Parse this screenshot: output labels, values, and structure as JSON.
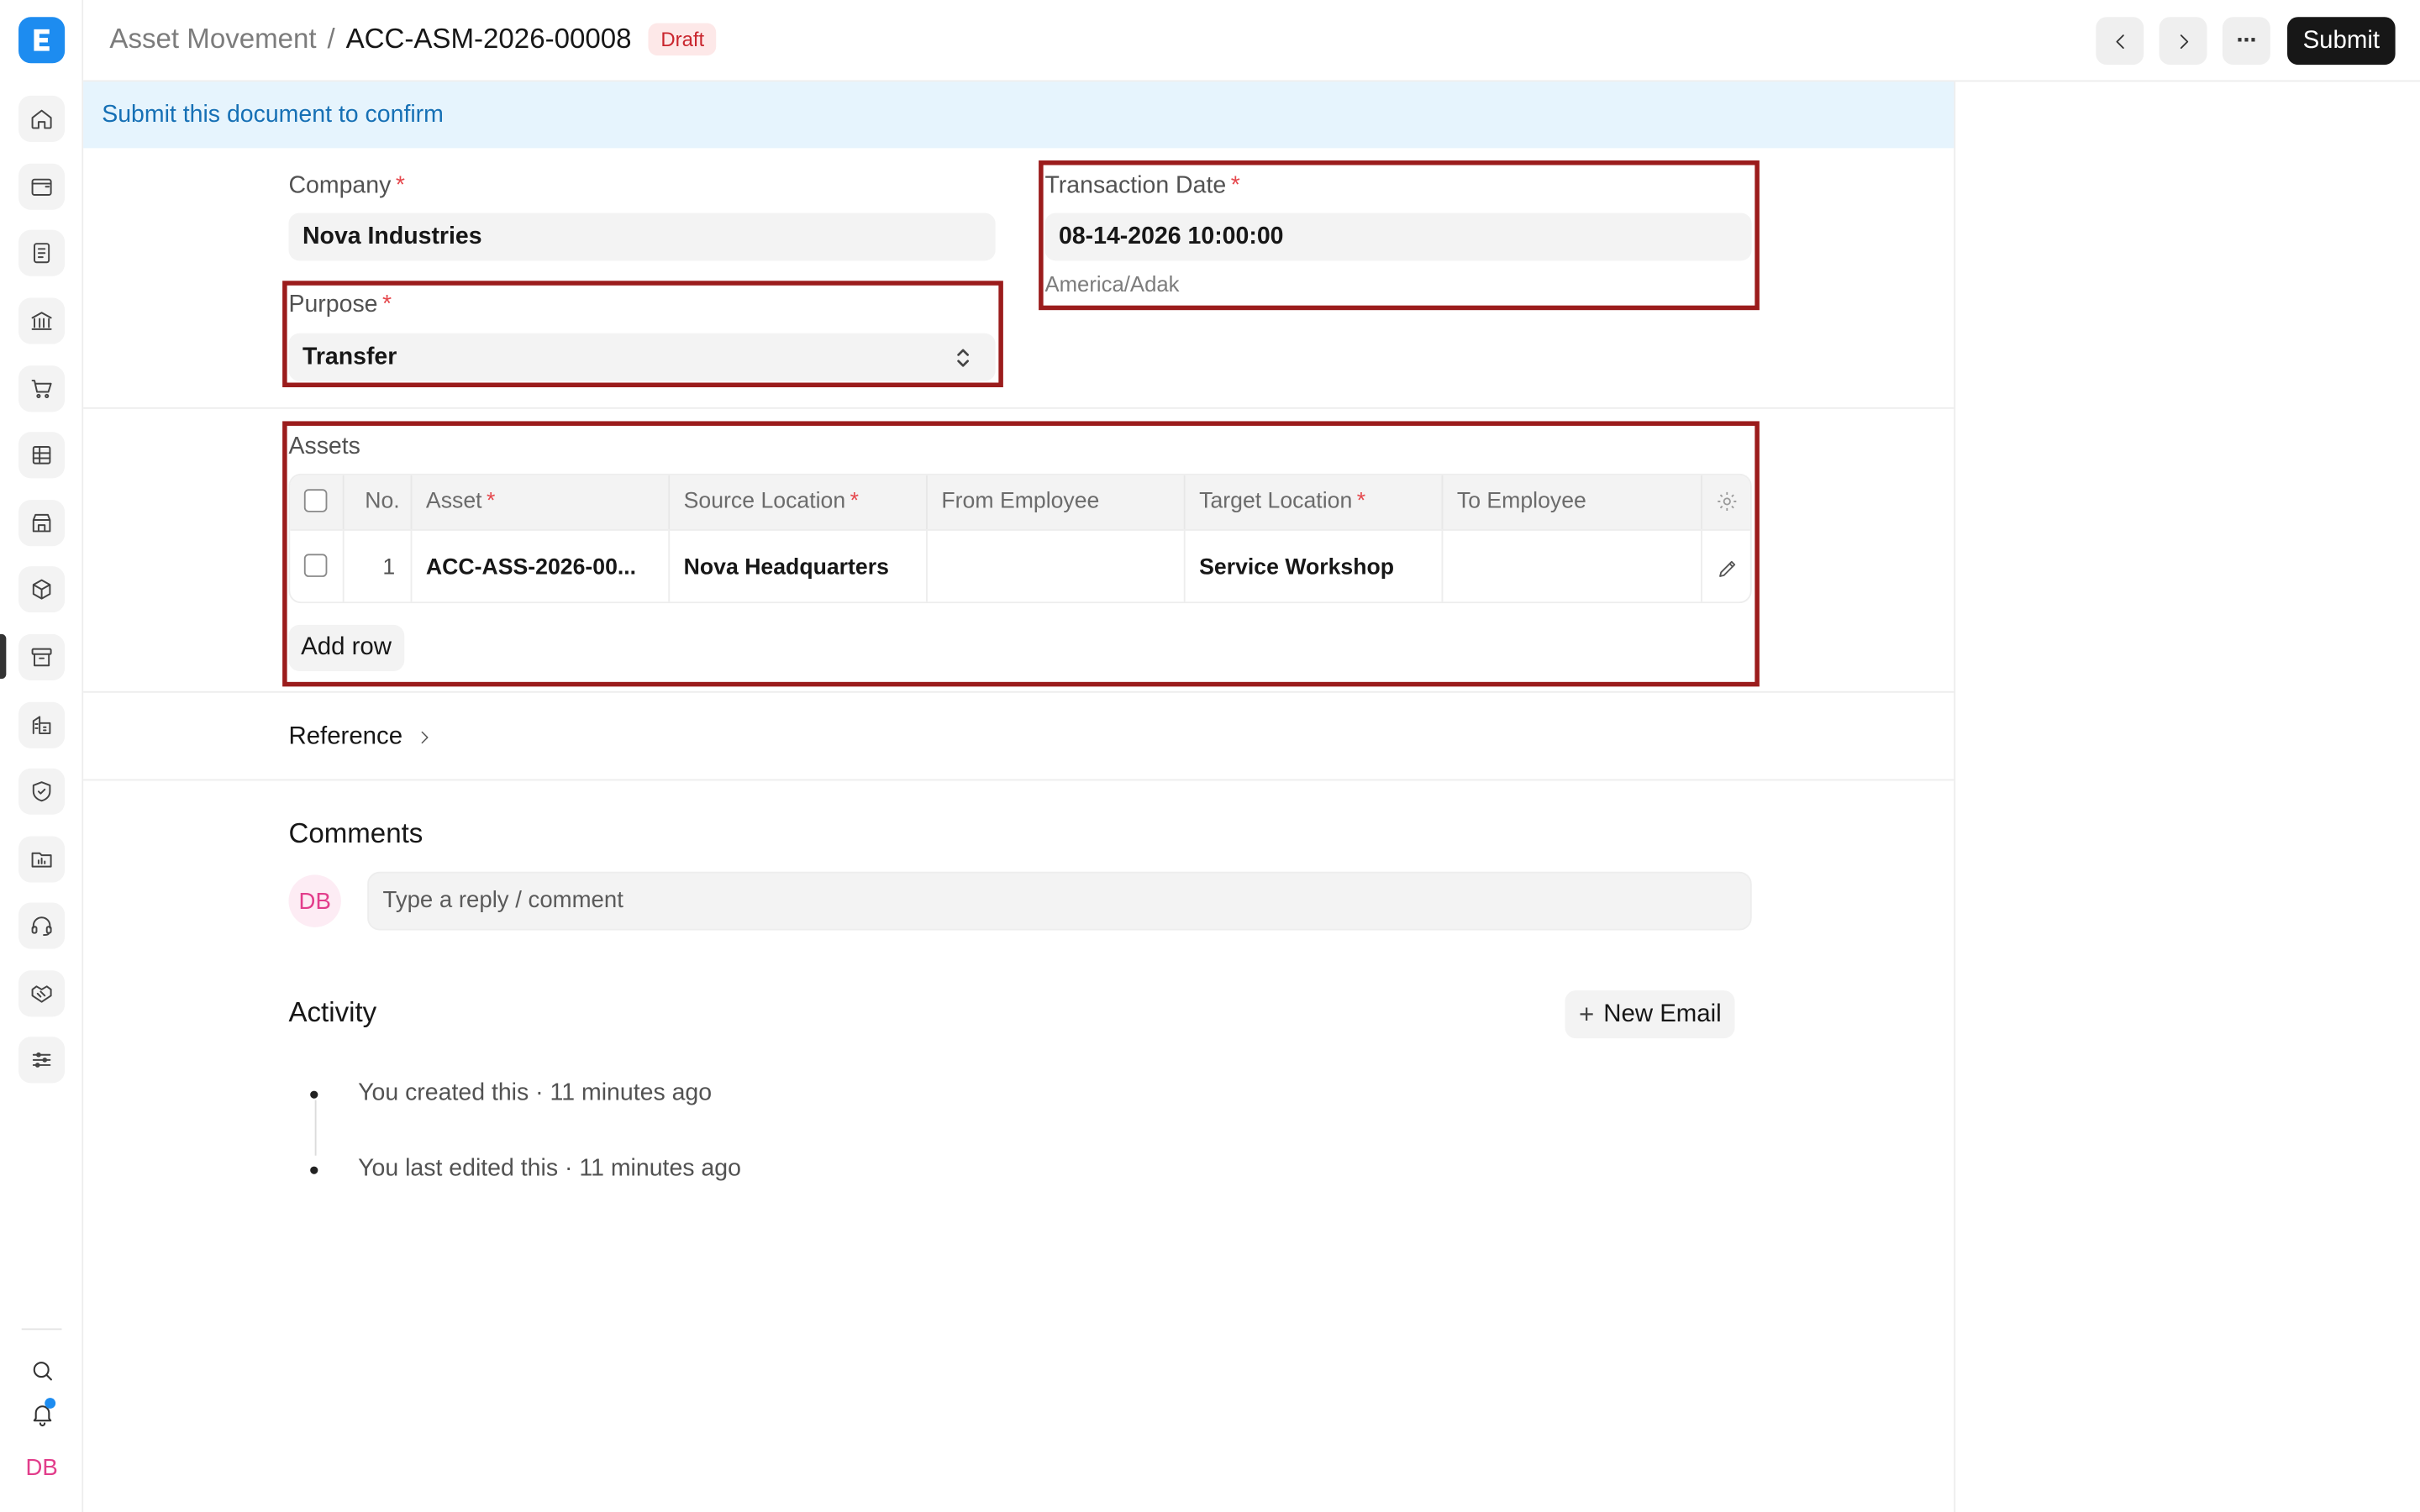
{
  "header": {
    "doctype": "Asset Movement",
    "separator": "/",
    "doc_name": "ACC-ASM-2026-00008",
    "status": "Draft",
    "submit_label": "Submit",
    "more_label": "···"
  },
  "banner": {
    "text": "Submit this document to confirm"
  },
  "form": {
    "company_label": "Company",
    "company_value": "Nova Industries",
    "purpose_label": "Purpose",
    "purpose_value": "Transfer",
    "txn_date_label": "Transaction Date",
    "txn_date_value": "08-14-2026 10:00:00",
    "timezone": "America/Adak",
    "required_mark": "*"
  },
  "assets": {
    "label": "Assets",
    "columns": [
      "No.",
      "Asset",
      "Source Location",
      "From Employee",
      "Target Location",
      "To Employee"
    ],
    "rows": [
      {
        "no": "1",
        "asset": "ACC-ASS-2026-00...",
        "source_location": "Nova Headquarters",
        "from_employee": "",
        "target_location": "Service Workshop",
        "to_employee": ""
      }
    ],
    "add_row_label": "Add row"
  },
  "reference": {
    "label": "Reference"
  },
  "comments": {
    "title": "Comments",
    "avatar_initials": "DB",
    "placeholder": "Type a reply / comment"
  },
  "activity": {
    "title": "Activity",
    "new_email_label": "New Email",
    "items": [
      "You created this · 11 minutes ago",
      "You last edited this · 11 minutes ago"
    ]
  },
  "sidebar": {
    "avatar_initials": "DB",
    "icons": [
      "home-icon",
      "wallet-icon",
      "document-icon",
      "bank-icon",
      "cart-icon",
      "table-icon",
      "store-icon",
      "package-icon",
      "archive-icon",
      "building-icon",
      "shield-icon",
      "folder-chart-icon",
      "headset-icon",
      "handshake-icon",
      "sliders-icon",
      "search-icon",
      "bell-icon"
    ]
  },
  "colors": {
    "accent": "#1d8cf0",
    "highlight_border": "#9b1c1c",
    "draft_badge_bg": "#fde8e8",
    "draft_badge_text": "#c9252d",
    "banner_bg": "#e6f4fd",
    "banner_text": "#1670b5"
  }
}
